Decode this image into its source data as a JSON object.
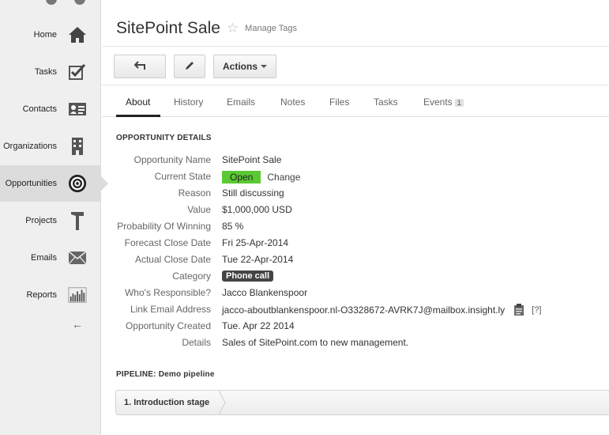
{
  "sidebar": {
    "items": [
      {
        "label": "Home",
        "icon": "home-icon"
      },
      {
        "label": "Tasks",
        "icon": "checkbox-icon"
      },
      {
        "label": "Contacts",
        "icon": "contact-card-icon"
      },
      {
        "label": "Organizations",
        "icon": "building-icon"
      },
      {
        "label": "Opportunities",
        "icon": "target-icon",
        "active": true
      },
      {
        "label": "Projects",
        "icon": "hammer-icon"
      },
      {
        "label": "Emails",
        "icon": "envelope-icon"
      },
      {
        "label": "Reports",
        "icon": "bar-chart-icon"
      }
    ],
    "collapse_glyph": "←"
  },
  "header": {
    "title": "SitePoint Sale",
    "manage_tags": "Manage Tags"
  },
  "toolbar": {
    "actions_label": "Actions"
  },
  "tabs": {
    "items": [
      {
        "label": "About",
        "active": true
      },
      {
        "label": "History"
      },
      {
        "label": "Emails"
      },
      {
        "label": "Notes"
      },
      {
        "label": "Files"
      },
      {
        "label": "Tasks"
      },
      {
        "label": "Events",
        "badge": "1"
      }
    ]
  },
  "details": {
    "heading": "OPPORTUNITY DETAILS",
    "rows": [
      {
        "label": "Opportunity Name",
        "value": "SitePoint Sale"
      },
      {
        "label": "Current State",
        "value": "Open",
        "change": "Change"
      },
      {
        "label": "Reason",
        "value": "Still discussing"
      },
      {
        "label": "Value",
        "value": "$1,000,000 USD"
      },
      {
        "label": "Probability Of Winning",
        "value": "85 %"
      },
      {
        "label": "Forecast Close Date",
        "value": "Fri 25-Apr-2014"
      },
      {
        "label": "Actual Close Date",
        "value": "Tue 22-Apr-2014"
      },
      {
        "label": "Category",
        "value": "Phone call"
      },
      {
        "label": "Who's Responsible?",
        "value": "Jacco Blankenspoor"
      },
      {
        "label": "Link Email Address",
        "value": "jacco-aboutblankenspoor.nl-O3328672-AVRK7J@mailbox.insight.ly",
        "help": "[?]"
      },
      {
        "label": "Opportunity Created",
        "value": "Tue. Apr 22 2014"
      },
      {
        "label": "Details",
        "value": "Sales of SitePoint.com to new management."
      }
    ]
  },
  "pipeline": {
    "heading": "PIPELINE:",
    "name": "Demo pipeline",
    "stage": "1. Introduction stage"
  },
  "colors": {
    "open_state": "#5ac933",
    "category_pill": "#444444",
    "sidebar_bg": "#efefef"
  }
}
